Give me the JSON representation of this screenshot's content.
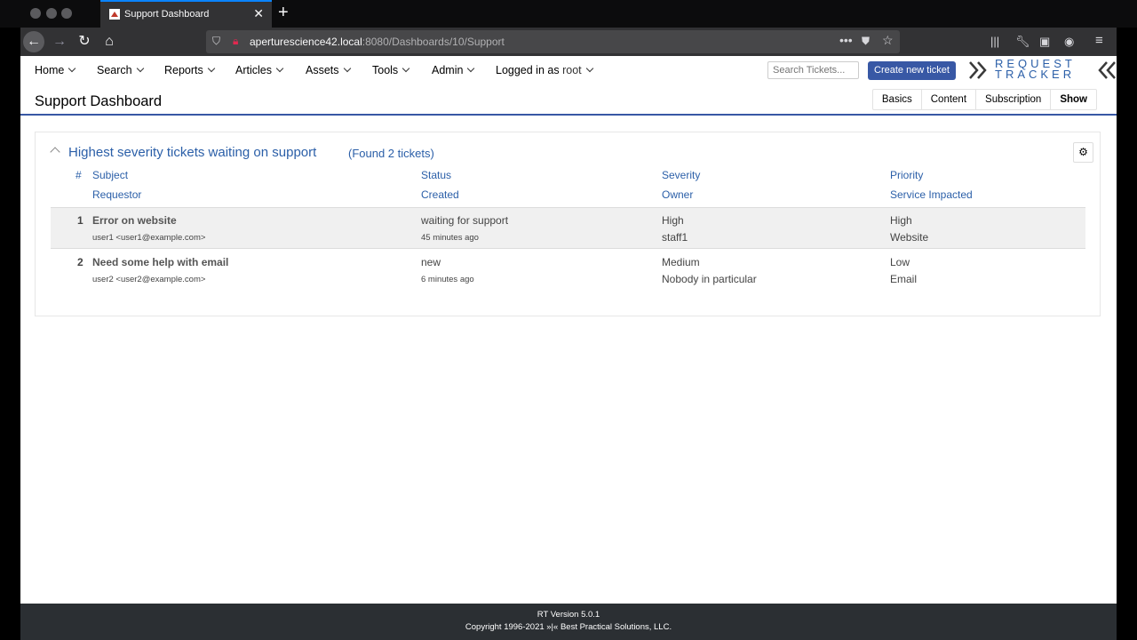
{
  "browser": {
    "tab_title": "Support Dashboard",
    "new_tab": "+",
    "url_host": "aperturescience42.local",
    "url_path": ":8080/Dashboards/10/Support"
  },
  "menu": {
    "items": [
      "Home",
      "Search",
      "Reports",
      "Articles",
      "Assets",
      "Tools",
      "Admin"
    ],
    "logged_in_prefix": "Logged in as",
    "logged_in_user": "root",
    "search_placeholder": "Search Tickets...",
    "create_label": "Create new ticket",
    "logo_line1": "REQUEST",
    "logo_line2": "TRACKER"
  },
  "page": {
    "title": "Support Dashboard",
    "tabs": [
      "Basics",
      "Content",
      "Subscription",
      "Show"
    ],
    "active_tab": "Show"
  },
  "panel": {
    "title": "Highest severity tickets waiting on support",
    "count": "(Found 2 tickets)",
    "headers_row1": [
      "#",
      "Subject",
      "Status",
      "Severity",
      "Priority"
    ],
    "headers_row2": [
      "Requestor",
      "Created",
      "Owner",
      "Service Impacted"
    ],
    "tickets": [
      {
        "num": "1",
        "subject": "Error on website",
        "status": "waiting for support",
        "severity": "High",
        "priority": "High",
        "requestor": "user1 <user1@example.com>",
        "created": "45 minutes ago",
        "owner": "staff1",
        "service": "Website"
      },
      {
        "num": "2",
        "subject": "Need some help with email",
        "status": "new",
        "severity": "Medium",
        "priority": "Low",
        "requestor": "user2 <user2@example.com>",
        "created": "6 minutes ago",
        "owner": "Nobody in particular",
        "service": "Email"
      }
    ]
  },
  "footer": {
    "version": "RT Version 5.0.1",
    "copyright": "Copyright 1996-2021 »|« Best Practical Solutions, LLC."
  },
  "icons": [
    "back-icon",
    "forward-icon",
    "reload-icon",
    "home-icon",
    "shield-icon",
    "insecure-lock-icon",
    "more-icon",
    "pocket-icon",
    "bookmark-star-icon",
    "library-icon",
    "wrench-icon",
    "sidebar-icon",
    "account-icon",
    "hamburger-menu-icon",
    "gear-icon",
    "collapse-chevron-icon"
  ],
  "colors": {
    "accent": "#3858a5",
    "link": "#2b5fa8",
    "footer": "#2b2f33"
  }
}
